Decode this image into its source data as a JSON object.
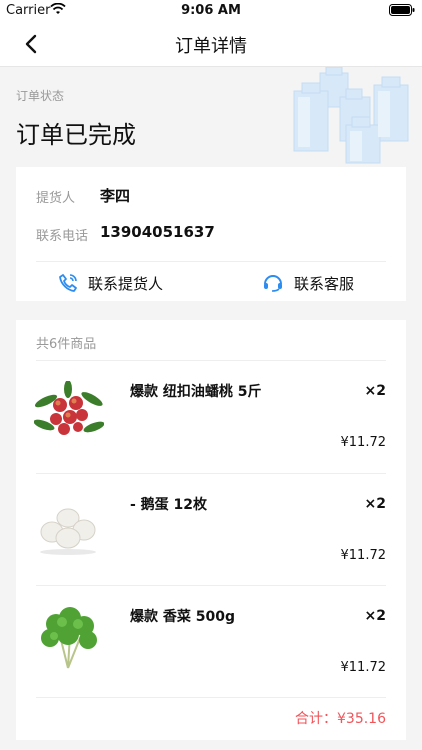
{
  "status_bar": {
    "carrier": "Carrier",
    "time": "9:06 AM"
  },
  "nav": {
    "title": "订单详情",
    "back_icon": "chevron-left-icon"
  },
  "order_status": {
    "label": "订单状态",
    "value": "订单已完成"
  },
  "contact": {
    "pickup_label": "提货人",
    "pickup_name": "李四",
    "phone_label": "联系电话",
    "phone": "13904051637",
    "call_pickup": "联系提货人",
    "call_service": "联系客服"
  },
  "items": {
    "count_label": "共6件商品",
    "list": [
      {
        "name": "爆款 纽扣油蟠桃 5斤",
        "qty": "×2",
        "price": "¥11.72",
        "image": "peach"
      },
      {
        "name": "- 鹅蛋 12枚",
        "qty": "×2",
        "price": "¥11.72",
        "image": "eggs"
      },
      {
        "name": "爆款 香菜 500g",
        "qty": "×2",
        "price": "¥11.72",
        "image": "coriander"
      }
    ],
    "total": "合计：¥35.16"
  },
  "colors": {
    "accent_blue": "#2d8cf0",
    "price_red": "#f0555a"
  }
}
